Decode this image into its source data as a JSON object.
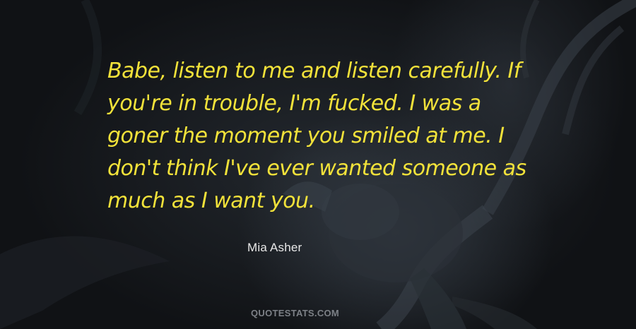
{
  "quote": {
    "lines": [
      "Babe, listen to me and listen carefully. If",
      "you're in trouble, I'm fucked. I was a",
      "goner the moment you smiled at me. I",
      "don't think I've ever wanted someone as",
      "much as I want you."
    ]
  },
  "author": "Mia Asher",
  "watermark": "QUOTESTATS.COM",
  "colors": {
    "quote_text": "#f2e23a",
    "author_text": "#e8e8e8",
    "watermark_text": "#7c8086",
    "background": "#15181c"
  },
  "background_image": "dark-dragon-illustration"
}
